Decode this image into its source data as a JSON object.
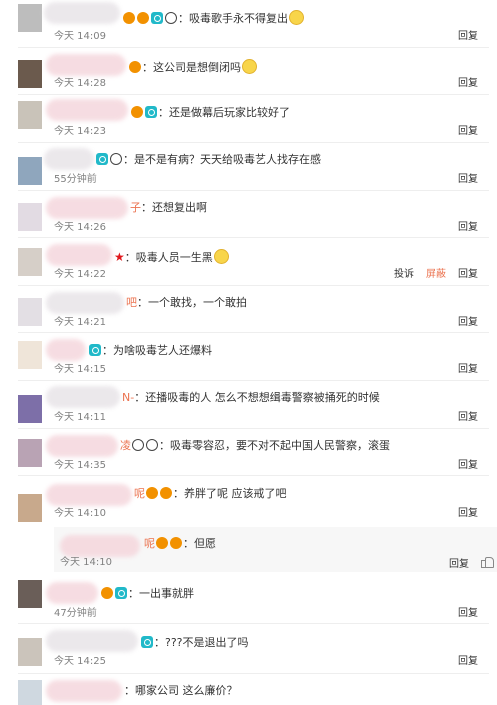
{
  "colors": {
    "name_accent": "#eb7350",
    "time": "#808080",
    "blur_pink": "#f5d7dd"
  },
  "comments": [
    {
      "text": "：吸毒歌手永不得复出",
      "time": "今天 14:09",
      "reply": "回复"
    },
    {
      "text": "：这公司是想倒闭吗",
      "time": "今天 14:28",
      "reply": "回复"
    },
    {
      "text": "：还是做幕后玩家比较好了",
      "time": "今天 14:23",
      "reply": "回复"
    },
    {
      "text": "：是不是有病？天天给吸毒艺人找存在感",
      "time": "55分钟前",
      "reply": "回复"
    },
    {
      "name_fragment": "子",
      "text": "：还想复出啊",
      "time": "今天 14:26",
      "reply": "回复"
    },
    {
      "text": "：吸毒人员一生黑",
      "time": "今天 14:22",
      "report": "投诉",
      "block": "屏蔽",
      "reply": "回复"
    },
    {
      "name_fragment": "吧",
      "text": "：一个敢找，一个敢拍",
      "time": "今天 14:21",
      "reply": "回复"
    },
    {
      "text": "：为啥吸毒艺人还爆料",
      "time": "今天 14:15",
      "reply": "回复"
    },
    {
      "name_fragment": "N-",
      "text": "：还播吸毒的人 怎么不想想缉毒警察被捅死的时候",
      "time": "今天 14:11",
      "reply": "回复"
    },
    {
      "name_fragment": "凌",
      "text": "：吸毒零容忍，要不对不起中国人民警察，滚蛋",
      "time": "今天 14:35",
      "reply": "回复"
    },
    {
      "name_fragment": "呢",
      "text": "：养胖了呢 应该戒了吧",
      "time": "今天 14:10",
      "reply": "回复"
    },
    {
      "name_fragment": "呢",
      "text": "：但愿",
      "time": "今天 14:10",
      "reply": "回复"
    },
    {
      "text": "：一出事就胖",
      "time": "47分钟前",
      "reply": "回复"
    },
    {
      "text": "：???不是退出了吗",
      "time": "今天 14:25",
      "reply": "回复"
    },
    {
      "text": "：哪家公司 这么廉价？",
      "time": "",
      "reply": ""
    }
  ]
}
